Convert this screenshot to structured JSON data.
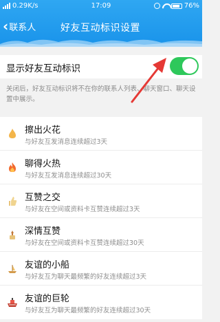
{
  "status_bar": {
    "speed": "0.29K/s",
    "time": "17:09",
    "battery": "76%"
  },
  "nav": {
    "back_label": "联系人",
    "title": "好友互动标识设置"
  },
  "toggle": {
    "label": "显示好友互动标识",
    "on": true,
    "color_on": "#2ec85b"
  },
  "description": "关闭后，好友互动标识将不在你的联系人列表、聊天窗口、聊天设置中展示。",
  "items": [
    {
      "icon": "spark-icon",
      "title": "擦出火花",
      "subtitle": "与好友互发消息连续超过3天"
    },
    {
      "icon": "fire-icon",
      "title": "聊得火热",
      "subtitle": "与好友互发消息连续超过30天"
    },
    {
      "icon": "thumb-icon",
      "title": "互赞之交",
      "subtitle": "与好友在空间或资料卡互赞连续超过3天"
    },
    {
      "icon": "deep-thumb-icon",
      "title": "深情互赞",
      "subtitle": "与好友在空间或资料卡互赞连续超过30天"
    },
    {
      "icon": "small-boat-icon",
      "title": "友谊的小船",
      "subtitle": "与好友互为聊天最频繁的好友连续超过3天"
    },
    {
      "icon": "big-ship-icon",
      "title": "友谊的巨轮",
      "subtitle": "与好友互为聊天最频繁的好友连续超过30天"
    }
  ],
  "colors": {
    "header": "#1e9bee",
    "arrow": "#e53935"
  }
}
